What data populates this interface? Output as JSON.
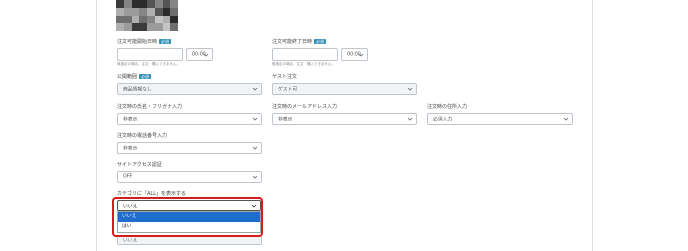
{
  "form": {
    "order_start": {
      "label": "注文可能開始日時",
      "badge": "必須",
      "time": "00:00",
      "hint": "無指定の場合、注文・購入できません。"
    },
    "order_end": {
      "label": "注文可能終了日時",
      "badge": "必須",
      "time": "00:00",
      "hint": "無指定の場合、注文・購入できません。"
    },
    "visibility": {
      "label": "公開範囲",
      "badge": "必須",
      "value": "商品情報なし"
    },
    "guest_order": {
      "label": "ゲスト注文",
      "value": "ゲスト可"
    },
    "name_kana": {
      "label": "注文時の氏名・フリガナ入力",
      "value": "非表示"
    },
    "email": {
      "label": "注文時のメールアドレス入力",
      "value": "非表示"
    },
    "address": {
      "label": "注文時の住所入力",
      "value": "必須入力"
    },
    "phone": {
      "label": "注文時の電話番号入力",
      "value": "非表示"
    },
    "site_access": {
      "label": "サイトアクセス認証",
      "value": "OFF"
    },
    "show_all_category": {
      "label": "カテゴリに「ALL」を表示する",
      "value": "いいえ",
      "options": [
        "いいえ",
        "はい"
      ],
      "selected_index": 0,
      "below_value": "いいえ"
    }
  },
  "colors": {
    "highlight": "#d81b1b",
    "selected_option": "#1e6ccc",
    "badge": "#2f8fb5"
  }
}
